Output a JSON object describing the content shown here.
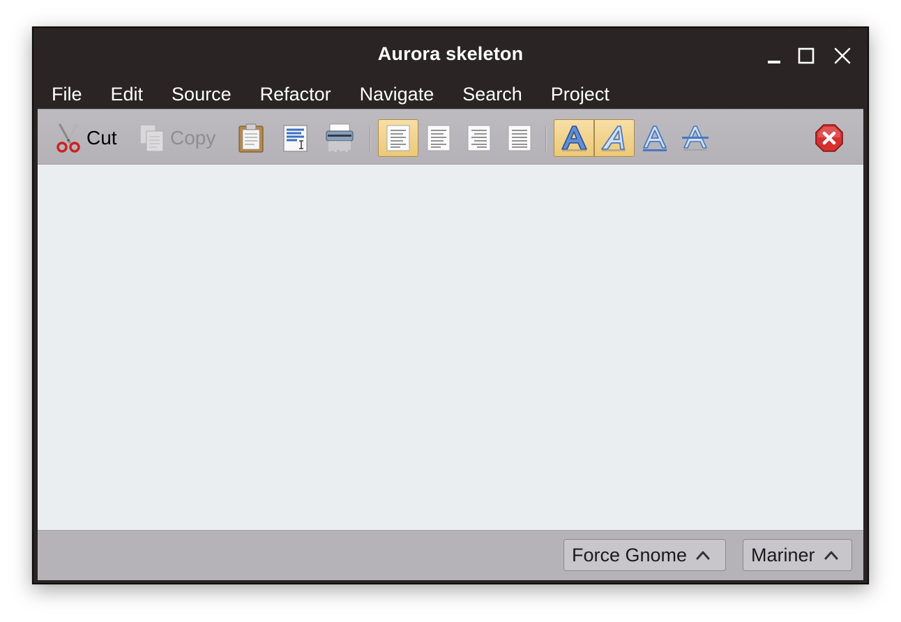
{
  "window": {
    "title": "Aurora skeleton",
    "controls": [
      "minimize-icon",
      "maximize-icon",
      "close-icon"
    ]
  },
  "menubar": {
    "items": [
      {
        "label": "File"
      },
      {
        "label": "Edit"
      },
      {
        "label": "Source"
      },
      {
        "label": "Refactor"
      },
      {
        "label": "Navigate"
      },
      {
        "label": "Search"
      },
      {
        "label": "Project"
      }
    ]
  },
  "toolbar": {
    "cut_label": "Cut",
    "copy_label": "Copy",
    "copy_enabled": false,
    "alignment_selected": "left",
    "font_styles": {
      "bold": true,
      "italic": true,
      "underline": false,
      "strikethrough": false
    },
    "icons": [
      "scissors-icon",
      "copy-icon",
      "clipboard-icon",
      "find-replace-icon",
      "shredder-icon",
      "align-left-icon",
      "align-center-icon",
      "align-right-icon",
      "align-justify-icon",
      "bold-icon",
      "italic-icon",
      "underline-icon",
      "strikethrough-icon",
      "stop-icon"
    ]
  },
  "statusbar": {
    "combo1": "Force Gnome",
    "combo2": "Mariner"
  },
  "colors": {
    "titlebar": "#2a2424",
    "toolbar": "#b9b7bb",
    "content": "#ebeef1",
    "toggle_on": "#f2d490",
    "font_icon_blue": "#4a7fd0",
    "stop_red": "#d42a2a"
  }
}
